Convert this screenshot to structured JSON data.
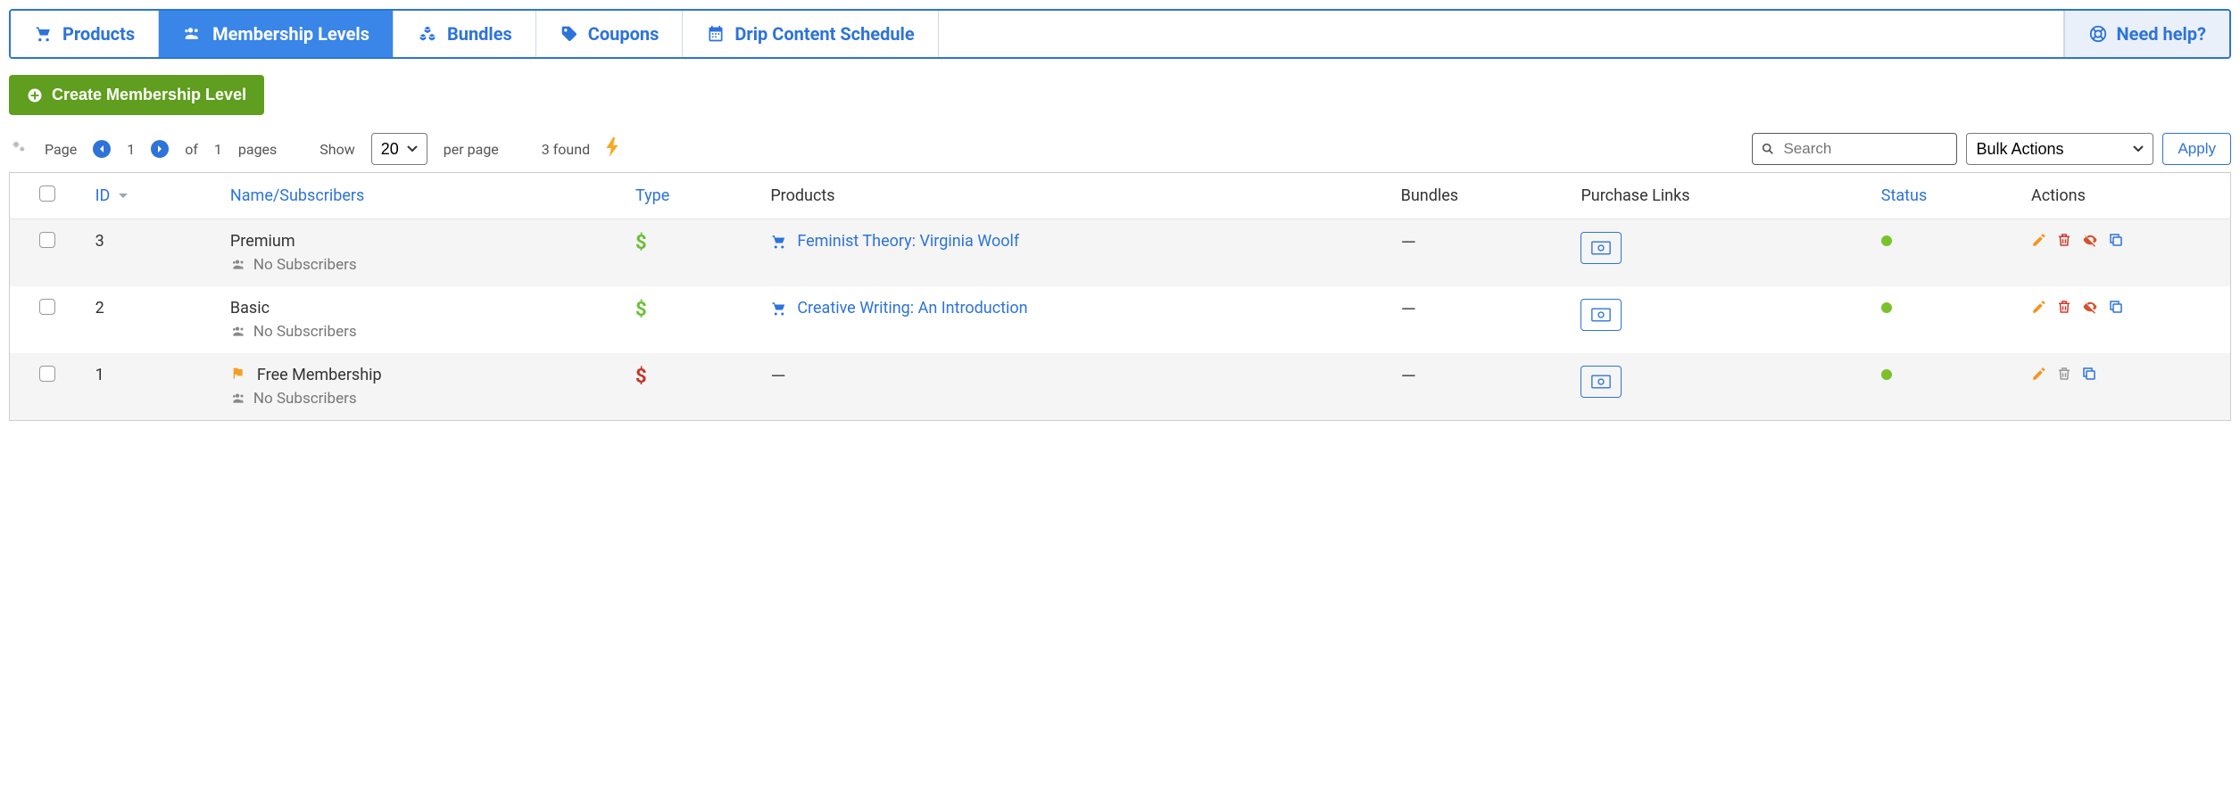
{
  "tabs": {
    "products": "Products",
    "membership": "Membership Levels",
    "bundles": "Bundles",
    "coupons": "Coupons",
    "drip": "Drip Content Schedule",
    "help": "Need help?"
  },
  "create_button": "Create Membership Level",
  "pager": {
    "page_label": "Page",
    "current": "1",
    "of_label": "of",
    "total": "1",
    "pages_label": "pages",
    "show_label": "Show",
    "per_page_value": "20",
    "per_page_label": "per page",
    "found_label": "3 found"
  },
  "search_placeholder": "Search",
  "bulk_label": "Bulk Actions",
  "apply_label": "Apply",
  "headers": {
    "id": "ID",
    "name": "Name/Subscribers",
    "type": "Type",
    "products": "Products",
    "bundles": "Bundles",
    "purchase": "Purchase Links",
    "status": "Status",
    "actions": "Actions"
  },
  "no_subs": "No Subscribers",
  "rows": [
    {
      "id": "3",
      "name": "Premium",
      "flag": false,
      "type": "green",
      "product": "Feminist Theory: Virginia Woolf",
      "bundles": "—",
      "status": "active",
      "hide_action": true,
      "del": true
    },
    {
      "id": "2",
      "name": "Basic",
      "flag": false,
      "type": "green",
      "product": "Creative Writing: An Introduction",
      "bundles": "—",
      "status": "active",
      "hide_action": true,
      "del": true
    },
    {
      "id": "1",
      "name": "Free Membership",
      "flag": true,
      "type": "red",
      "product": "",
      "bundles": "—",
      "status": "active",
      "hide_action": false,
      "del": false
    }
  ]
}
